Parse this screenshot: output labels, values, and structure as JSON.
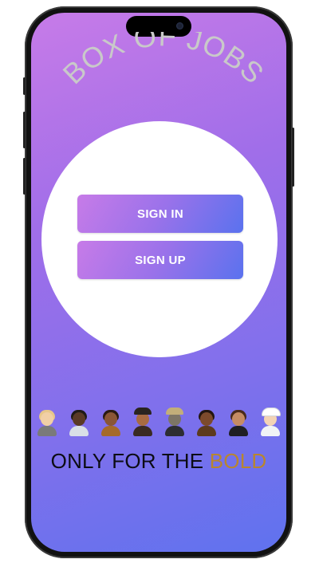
{
  "app": {
    "title": "BOX OF JOBS"
  },
  "auth": {
    "sign_in_label": "SIGN IN",
    "sign_up_label": "SIGN UP"
  },
  "people_row": [
    {
      "icon": "person-with-laptop-icon"
    },
    {
      "icon": "man-office-worker-icon"
    },
    {
      "icon": "woman-cook-icon"
    },
    {
      "icon": "graduate-icon"
    },
    {
      "icon": "pilot-icon"
    },
    {
      "icon": "man-artist-icon"
    },
    {
      "icon": "woman-judge-icon"
    },
    {
      "icon": "health-worker-icon"
    }
  ],
  "tagline": {
    "prefix": "ONLY FOR THE ",
    "accent": "BOLD"
  },
  "colors": {
    "gradient_top": "#c77be8",
    "gradient_bottom": "#5f72ee",
    "title_color": "#c9c9c9",
    "accent_word": "#b8862e",
    "tagline_text": "#0c0c14"
  }
}
